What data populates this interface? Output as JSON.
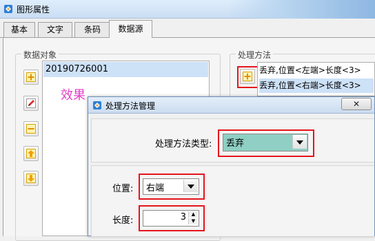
{
  "window": {
    "title": "图形属性",
    "app_icon": "app-logo-icon"
  },
  "tabs": [
    {
      "label": "基本"
    },
    {
      "label": "文字"
    },
    {
      "label": "条码"
    },
    {
      "label": "数据源",
      "active": true
    }
  ],
  "data_object": {
    "group_label": "数据对象",
    "items": [
      "20190726001"
    ],
    "side_buttons": [
      "add-icon",
      "edit-icon",
      "remove-icon",
      "move-up-icon",
      "move-down-icon"
    ]
  },
  "effect_label": "效果",
  "processing": {
    "group_label": "处理方法",
    "items": [
      "丢弃,位置<左端>长度<3>",
      "丢弃,位置<右端>长度<3>"
    ],
    "selected_index": 1,
    "add_icon": "add-icon"
  },
  "dialog": {
    "title": "处理方法管理",
    "close_icon": "close-icon",
    "type_label": "处理方法类型:",
    "type_value": "丢弃",
    "position_label": "位置:",
    "position_value": "右端",
    "length_label": "长度:",
    "length_value": "3"
  },
  "colors": {
    "highlight": "#e5141b",
    "selection": "#cde1f7",
    "combo_type_bg": "#8fcfc4",
    "effect_text": "#e040c8"
  }
}
